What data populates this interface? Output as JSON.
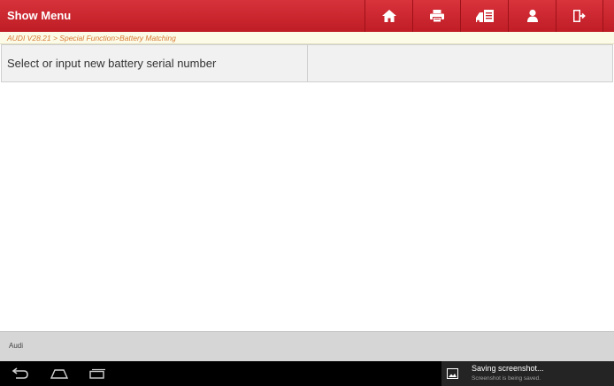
{
  "header": {
    "title": "Show Menu",
    "toolbar": [
      {
        "icon": "home-icon"
      },
      {
        "icon": "print-icon"
      },
      {
        "icon": "report-icon"
      },
      {
        "icon": "user-icon"
      },
      {
        "icon": "exit-icon"
      }
    ]
  },
  "breadcrumb": "AUDI V28.21 > Special Function>Battery Matching",
  "content": {
    "row_label": "Select or input new battery serial number",
    "row_value": ""
  },
  "footer": {
    "vehicle": "Audi"
  },
  "navbar": {
    "buttons": [
      "back-icon",
      "home-icon",
      "recent-apps-icon"
    ]
  },
  "notification": {
    "icon": "image-icon",
    "title": "Saving screenshot...",
    "subtitle": "Screenshot is being saved."
  },
  "colors": {
    "header_red": "#c8252e",
    "breadcrumb_text": "#d97a34",
    "row_background": "#f1f1f1",
    "footer_background": "#d6d6d6",
    "navbar_background": "#000000"
  }
}
